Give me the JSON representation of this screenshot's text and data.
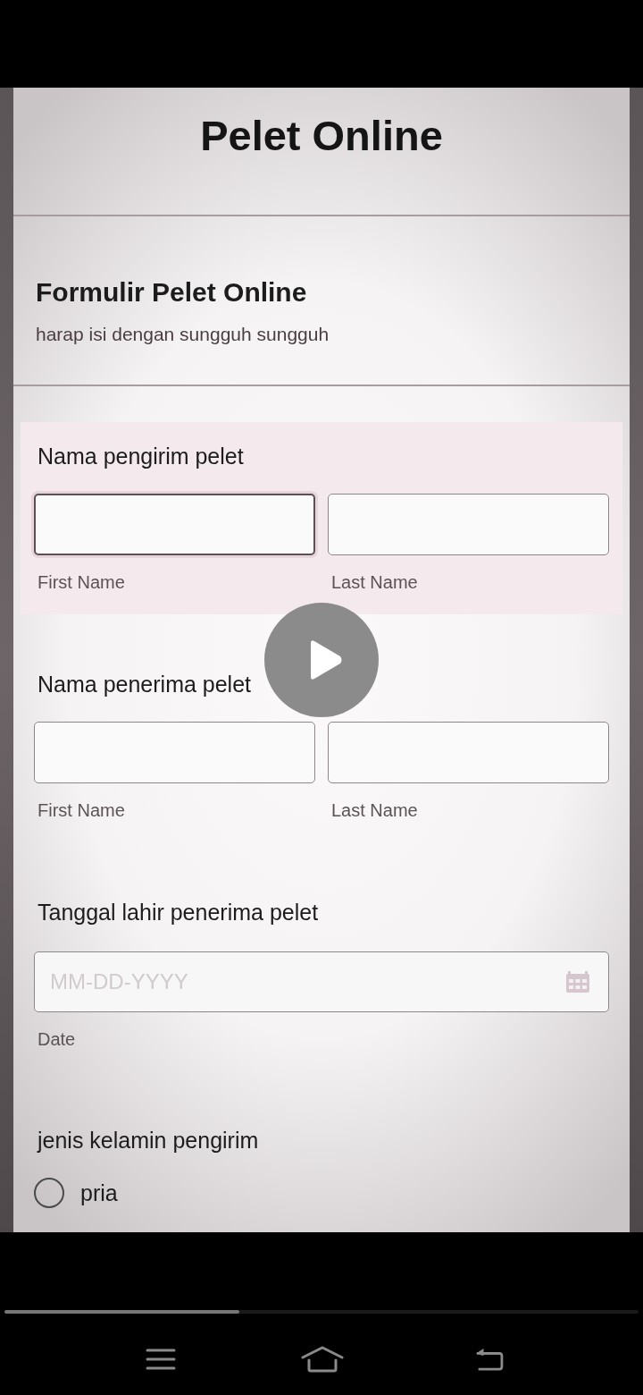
{
  "page": {
    "title": "Pelet Online"
  },
  "form": {
    "title": "Formulir Pelet Online",
    "description": "harap isi dengan sungguh sungguh"
  },
  "questions": [
    {
      "kind": "name",
      "label": "Nama pengirim pelet",
      "highlighted": true,
      "fields": [
        {
          "sublabel": "First Name",
          "focused": true
        },
        {
          "sublabel": "Last Name",
          "focused": false
        }
      ]
    },
    {
      "kind": "name",
      "label": "Nama penerima pelet",
      "highlighted": false,
      "fields": [
        {
          "sublabel": "First Name",
          "focused": false
        },
        {
          "sublabel": "Last Name",
          "focused": false
        }
      ]
    },
    {
      "kind": "date",
      "label": "Tanggal lahir penerima pelet",
      "highlighted": false,
      "placeholder": "MM-DD-YYYY",
      "sublabel": "Date"
    },
    {
      "kind": "radio",
      "label": "jenis kelamin pengirim",
      "highlighted": false,
      "options": [
        {
          "label": "pria",
          "selected": false
        }
      ]
    }
  ],
  "player": {
    "progress": {
      "level": 0.37
    }
  }
}
